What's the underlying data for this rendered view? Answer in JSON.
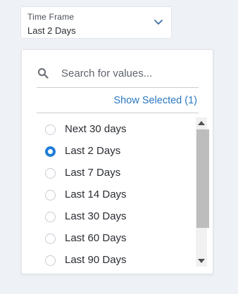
{
  "trigger": {
    "label": "Time Frame",
    "value": "Last 2 Days",
    "icon": "chevron-down-icon"
  },
  "search": {
    "placeholder": "Search for values...",
    "value": "",
    "icon": "search-icon"
  },
  "show_selected": {
    "label": "Show Selected (1)"
  },
  "options": [
    {
      "label": "Next 30 days",
      "selected": false
    },
    {
      "label": "Last 2 Days",
      "selected": true
    },
    {
      "label": "Last 7 Days",
      "selected": false
    },
    {
      "label": "Last 14 Days",
      "selected": false
    },
    {
      "label": "Last 30 Days",
      "selected": false
    },
    {
      "label": "Last 60 Days",
      "selected": false
    },
    {
      "label": "Last 90 Days",
      "selected": false
    }
  ],
  "colors": {
    "accent": "#1f7ed8",
    "link": "#2b79c2",
    "background": "#eef1f5"
  }
}
